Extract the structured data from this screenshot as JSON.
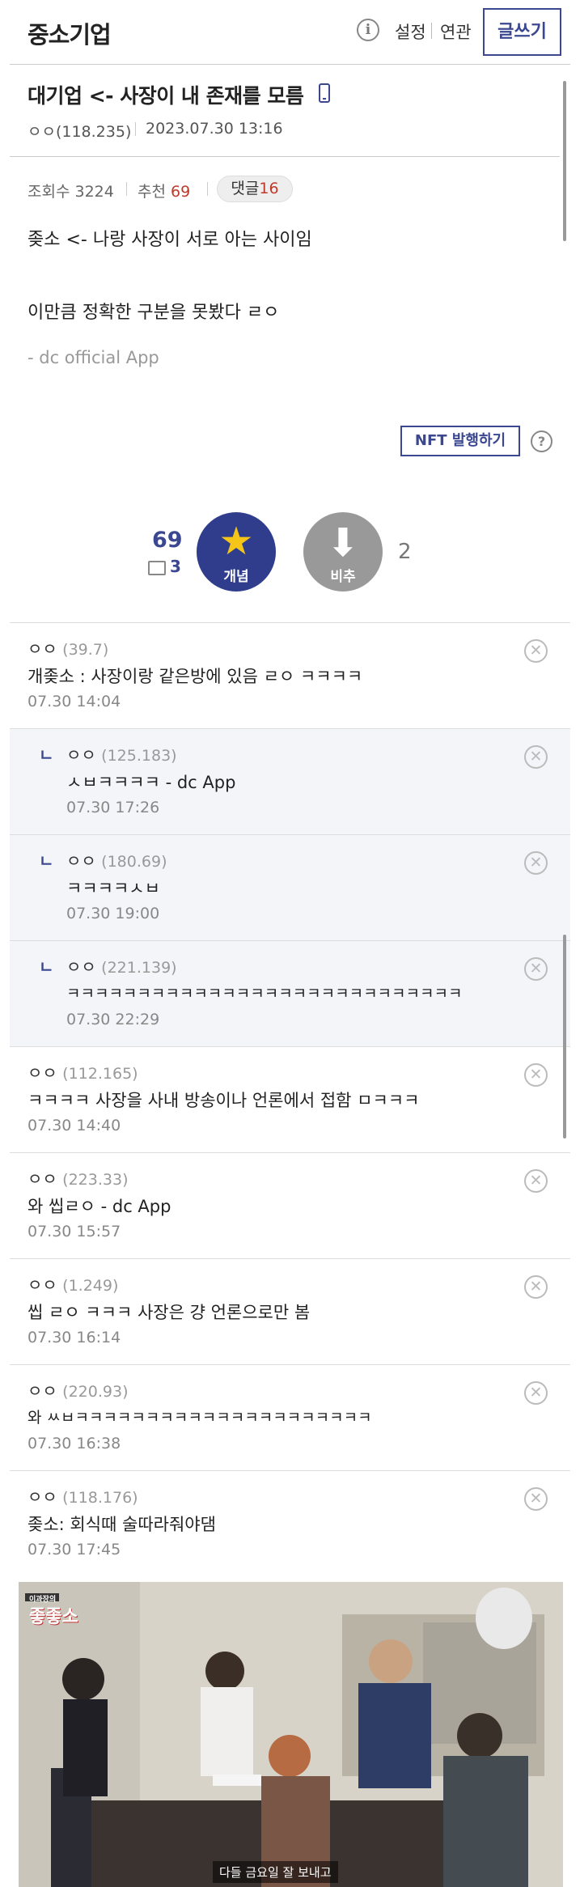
{
  "header": {
    "gallery_name": "중소기업",
    "info_glyph": "i",
    "links": [
      "설정",
      "연관"
    ],
    "write_label": "글쓰기"
  },
  "post": {
    "title": "대기업 <- 사장이 내 존재를 모름",
    "author": "ㅇㅇ(118.235)",
    "datetime": "2023.07.30 13:16",
    "views_label": "조회수 3224",
    "recommend_label": "추천",
    "recommend_count": "69",
    "comment_label": "댓글",
    "comment_count": "16",
    "body": [
      "좆소 <- 나랑 사장이 서로 아는 사이임",
      "이만큼 정확한 구분을 못봤다 ㄹㅇ"
    ],
    "signature": "- dc official App"
  },
  "nft": {
    "button_label": "NFT 발행하기",
    "help_glyph": "?"
  },
  "votes": {
    "up_count": "69",
    "fix_count": "3",
    "up_label": "개념",
    "down_label": "비추",
    "down_count": "2"
  },
  "comments": [
    {
      "author": "ㅇㅇ",
      "ip": "(39.7)",
      "text": "개좆소 : 사장이랑 같은방에 있음 ㄹㅇ ㅋㅋㅋㅋ",
      "date": "07.30 14:04"
    },
    {
      "author": "ㅇㅇ",
      "ip": "(125.183)",
      "text": "ㅅㅂㅋㅋㅋㅋ - dc App",
      "date": "07.30 17:26"
    },
    {
      "author": "ㅇㅇ",
      "ip": "(180.69)",
      "text": "ㅋㅋㅋㅋㅅㅂ",
      "date": "07.30 19:00"
    },
    {
      "author": "ㅇㅇ",
      "ip": "(221.139)",
      "text": "ㅋㅋㅋㅋㅋㅋㅋㅋㅋㅋㅋㅋㅋㅋㅋㅋㅋㅋㅋㅋㅋㅋㅋㅋㅋㅋㅋㅋ",
      "date": "07.30 22:29"
    },
    {
      "author": "ㅇㅇ",
      "ip": "(112.165)",
      "text": "ㅋㅋㅋㅋ 사장을 사내 방송이나 언론에서 접함 ㅁㅋㅋㅋ",
      "date": "07.30 14:40"
    },
    {
      "author": "ㅇㅇ",
      "ip": "(223.33)",
      "text": "와 씹ㄹㅇ - dc App",
      "date": "07.30 15:57"
    },
    {
      "author": "ㅇㅇ",
      "ip": "(1.249)",
      "text": "씹 ㄹㅇ ㅋㅋㅋ 사장은 걍 언론으로만 봄",
      "date": "07.30 16:14"
    },
    {
      "author": "ㅇㅇ",
      "ip": "(220.93)",
      "text": "와 ㅆㅂㅋㅋㅋㅋㅋㅋㅋㅋㅋㅋㅋㅋㅋㅋㅋㅋㅋㅋㅋㅋㅋ",
      "date": "07.30 16:38"
    },
    {
      "author": "ㅇㅇ",
      "ip": "(118.176)",
      "text": "좆소: 회식때 술따라줘야댐",
      "date": "07.30 17:45"
    }
  ],
  "reply_glyph": "ㄴ",
  "delete_glyph": "✕",
  "image": {
    "logo_small": "이과장의",
    "logo_big": "좋좋소",
    "subtitle": "다들 금요일 잘 보내고"
  },
  "colors": {
    "accent": "#3b4890",
    "red": "#c0392b",
    "reply_bg": "#f3f5f8"
  }
}
